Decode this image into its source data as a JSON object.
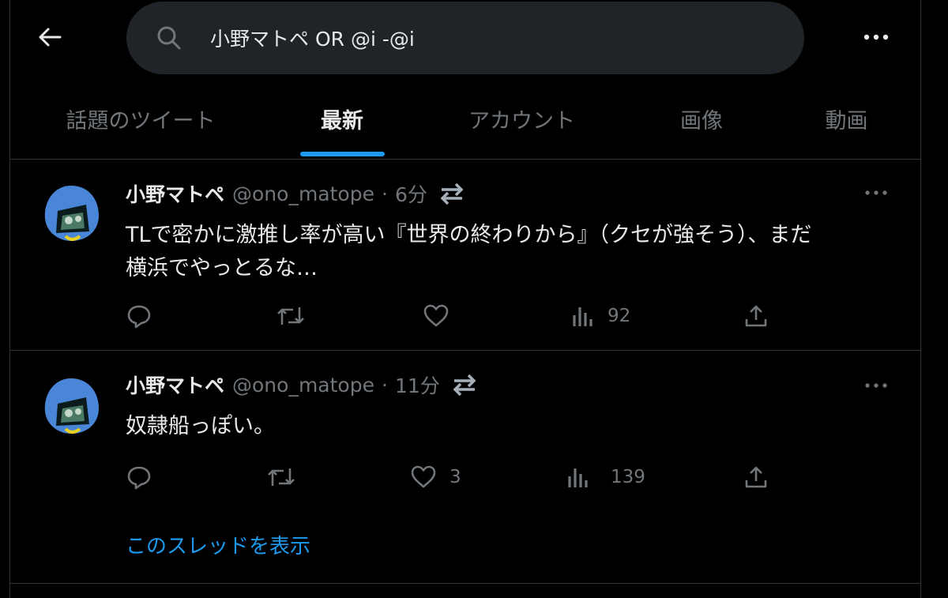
{
  "search": {
    "query": "小野マトペ OR @i -@i",
    "placeholder": ""
  },
  "tabs": [
    {
      "label": "話題のツイート"
    },
    {
      "label": "最新"
    },
    {
      "label": "アカウント"
    },
    {
      "label": "画像"
    },
    {
      "label": "動画"
    }
  ],
  "tweets": [
    {
      "name": "小野マトペ",
      "handle": "@ono_matope",
      "dot": "·",
      "time": "6分",
      "line1": "TLで密かに激推し率が高い『世界の終わりから』（クセが強そう）、まだ",
      "line2": "横浜でやっとるな…",
      "reply_count": "",
      "retweet_count": "",
      "like_count": "",
      "view_count": "92"
    },
    {
      "name": "小野マトペ",
      "handle": "@ono_matope",
      "dot": "·",
      "time": "11分",
      "line1": "奴隷船っぽい。",
      "line2": "",
      "reply_count": "",
      "retweet_count": "",
      "like_count": "3",
      "view_count": "139",
      "thread_link": "このスレッドを表示"
    }
  ],
  "colors": {
    "accent": "#1d9bf0",
    "muted": "#71767b",
    "text": "#e7e9ea",
    "background": "#000000",
    "search_bg": "#202327",
    "border": "#2f3336"
  }
}
